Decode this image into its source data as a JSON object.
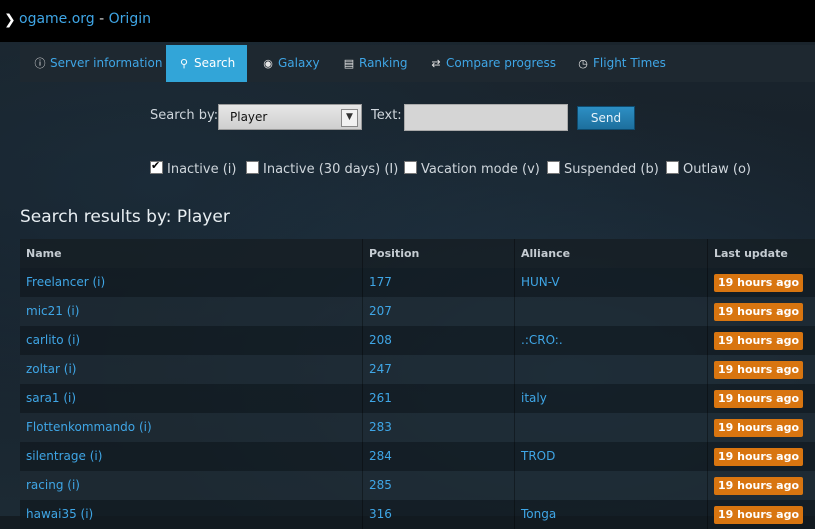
{
  "header": {
    "site": "ogame.org",
    "separator": " - ",
    "server": "Origin"
  },
  "nav": {
    "tabs": [
      {
        "label": "Server information",
        "icon": "info-icon"
      },
      {
        "label": "Search",
        "icon": "search-icon",
        "active": true
      },
      {
        "label": "Galaxy",
        "icon": "globe-icon"
      },
      {
        "label": "Ranking",
        "icon": "list-icon"
      },
      {
        "label": "Compare progress",
        "icon": "shuffle-icon"
      },
      {
        "label": "Flight Times",
        "icon": "clock-icon"
      }
    ]
  },
  "search": {
    "search_by_label": "Search by:",
    "search_by_value": "Player",
    "text_label": "Text:",
    "text_value": "",
    "send_label": "Send"
  },
  "filters": [
    {
      "label": "Inactive (i)",
      "checked": true
    },
    {
      "label": "Inactive (30 days) (I)",
      "checked": false
    },
    {
      "label": "Vacation mode (v)",
      "checked": false
    },
    {
      "label": "Suspended (b)",
      "checked": false
    },
    {
      "label": "Outlaw (o)",
      "checked": false
    }
  ],
  "results": {
    "title": "Search results by: Player",
    "columns": [
      "Name",
      "Position",
      "Alliance",
      "Last update"
    ],
    "rows": [
      {
        "name": "Freelancer (i)",
        "position": "177",
        "alliance": "HUN-V",
        "updated": "19 hours ago"
      },
      {
        "name": "mic21 (i)",
        "position": "207",
        "alliance": "",
        "updated": "19 hours ago"
      },
      {
        "name": "carlito (i)",
        "position": "208",
        "alliance": ".:CRO:.",
        "updated": "19 hours ago"
      },
      {
        "name": "zoltar (i)",
        "position": "247",
        "alliance": "",
        "updated": "19 hours ago"
      },
      {
        "name": "sara1 (i)",
        "position": "261",
        "alliance": "italy",
        "updated": "19 hours ago"
      },
      {
        "name": "Flottenkommando (i)",
        "position": "283",
        "alliance": "",
        "updated": "19 hours ago"
      },
      {
        "name": "silentrage (i)",
        "position": "284",
        "alliance": "TROD",
        "updated": "19 hours ago"
      },
      {
        "name": "racing (i)",
        "position": "285",
        "alliance": "",
        "updated": "19 hours ago"
      },
      {
        "name": "hawai35 (i)",
        "position": "316",
        "alliance": "Tonga",
        "updated": "19 hours ago"
      }
    ]
  },
  "colors": {
    "accent": "#32a5d8",
    "link": "#3fa6e6",
    "badge": "#d87510"
  }
}
